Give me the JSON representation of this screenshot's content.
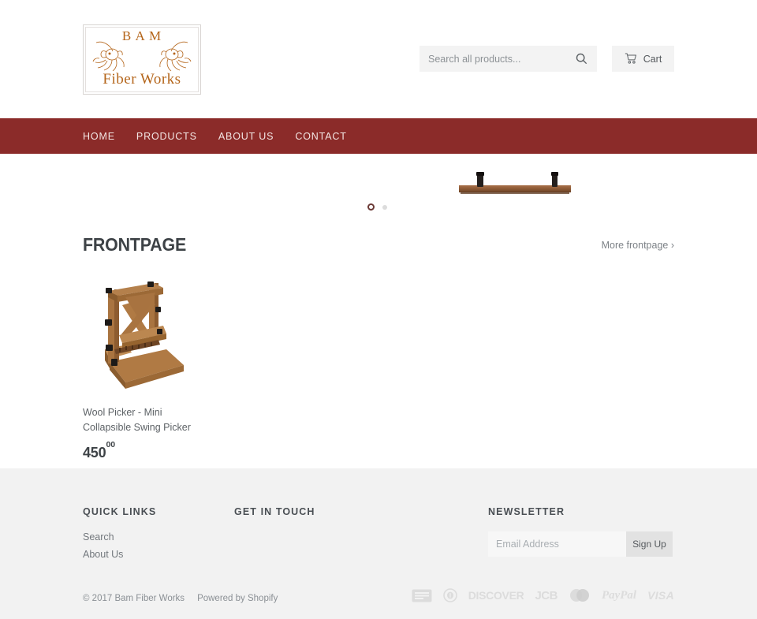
{
  "header": {
    "logo": {
      "line1": "B A M",
      "line2": "Fiber Works",
      "alt": "Bam Fiber Works"
    },
    "search": {
      "placeholder": "Search all products...",
      "value": "",
      "icon": "search-icon"
    },
    "cart": {
      "label": "Cart",
      "icon": "shopping-cart-icon"
    }
  },
  "nav": {
    "items": [
      {
        "label": "HOME"
      },
      {
        "label": "PRODUCTS"
      },
      {
        "label": "ABOUT US"
      },
      {
        "label": "CONTACT"
      }
    ]
  },
  "slideshow": {
    "slides": [
      {
        "alt": "Wooden beam with clamps"
      },
      {
        "alt": ""
      }
    ],
    "active_index": 0
  },
  "frontpage": {
    "title": "FRONTPAGE",
    "more_link": "More frontpage ›",
    "products": [
      {
        "title": "Wool Picker - Mini Collapsible Swing Picker",
        "price_whole": "450",
        "price_cents": "00",
        "image_alt": "Wool Picker - Mini Collapsible Swing Picker"
      }
    ]
  },
  "footer": {
    "quick_links": {
      "title": "QUICK LINKS",
      "items": [
        {
          "label": "Search"
        },
        {
          "label": "About Us"
        }
      ]
    },
    "get_in_touch": {
      "title": "GET IN TOUCH"
    },
    "newsletter": {
      "title": "NEWSLETTER",
      "placeholder": "Email Address",
      "value": "",
      "button": "Sign Up"
    },
    "copyright": "© 2017 Bam Fiber Works",
    "powered_by": "Powered by Shopify",
    "payment_icons": [
      {
        "name": "american-express-icon",
        "label": "American Express"
      },
      {
        "name": "diners-club-icon",
        "label": "Diners Club"
      },
      {
        "name": "discover-icon",
        "label": "DISCOVER"
      },
      {
        "name": "jcb-icon",
        "label": "JCB"
      },
      {
        "name": "mastercard-icon",
        "label": "Mastercard"
      },
      {
        "name": "paypal-icon",
        "label": "PayPal"
      },
      {
        "name": "visa-icon",
        "label": "VISA"
      }
    ]
  },
  "colors": {
    "nav_bg": "#8b2b29",
    "logo_text": "#b4651a",
    "footer_bg": "#f2f2f2",
    "field_bg": "#f3f3f3",
    "body_text": "#3d4246"
  }
}
